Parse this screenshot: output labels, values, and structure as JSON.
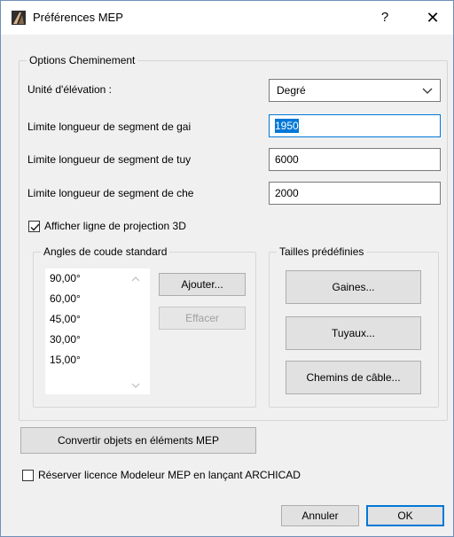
{
  "window": {
    "title": "Préférences MEP",
    "help": "?",
    "close": "✕"
  },
  "options": {
    "legend": "Options Cheminement",
    "elevation_unit_label": "Unité d'élévation :",
    "elevation_unit_value": "Degré",
    "duct_limit_label": "Limite longueur de segment de gai",
    "duct_limit_value": "1950",
    "pipe_limit_label": "Limite longueur de segment de tuy",
    "pipe_limit_value": "6000",
    "cable_limit_label": "Limite longueur de segment de che",
    "cable_limit_value": "2000",
    "show_3d_label": "Afficher ligne de projection 3D",
    "show_3d_checked": true
  },
  "angles": {
    "legend": "Angles de coude standard",
    "items": [
      "90,00°",
      "60,00°",
      "45,00°",
      "30,00°",
      "15,00°"
    ],
    "add_label": "Ajouter...",
    "delete_label": "Effacer"
  },
  "sizes": {
    "legend": "Tailles prédéfinies",
    "ducts_label": "Gaines...",
    "pipes_label": "Tuyaux...",
    "cables_label": "Chemins de câble..."
  },
  "convert_label": "Convertir objets en éléments MEP",
  "reserve_license_label": "Réserver licence Modeleur MEP en lançant ARCHICAD",
  "reserve_license_checked": false,
  "footer": {
    "cancel_label": "Annuler",
    "ok_label": "OK"
  }
}
